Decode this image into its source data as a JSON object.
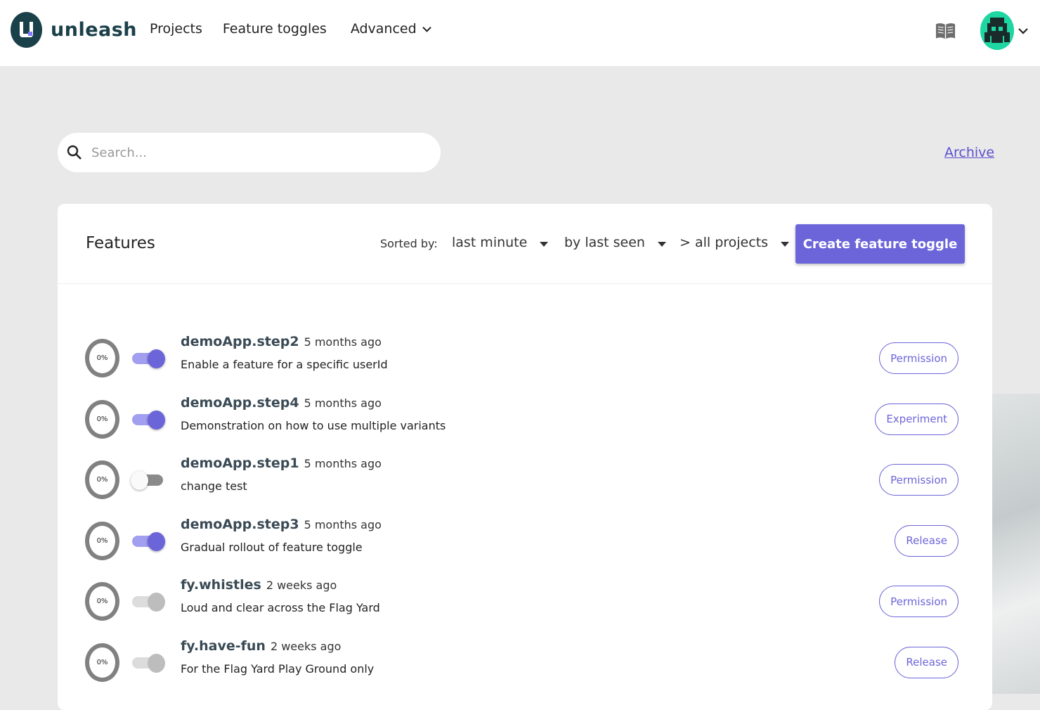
{
  "header": {
    "logo_text": "unleash",
    "nav": [
      "Projects",
      "Feature toggles",
      "Advanced"
    ],
    "icons": {
      "docs": "book-icon",
      "avatar": "user-avatar",
      "chevron": "chevron-down-icon"
    }
  },
  "search": {
    "placeholder": "Search..."
  },
  "archive_label": "Archive",
  "features_panel": {
    "title": "Features",
    "sorted_label": "Sorted by:",
    "filters": {
      "time": "last minute",
      "sort": "by last seen",
      "project": "> all projects"
    },
    "create_button": "Create feature toggle",
    "items": [
      {
        "name": "demoApp.step2",
        "time": "5 months ago",
        "description": "Enable a feature for a specific userId",
        "percent": "0%",
        "toggle": "on",
        "type": "Permission"
      },
      {
        "name": "demoApp.step4",
        "time": "5 months ago",
        "description": "Demonstration on how to use multiple variants",
        "percent": "0%",
        "toggle": "on",
        "type": "Experiment"
      },
      {
        "name": "demoApp.step1",
        "time": "5 months ago",
        "description": "change test",
        "percent": "0%",
        "toggle": "off",
        "type": "Permission"
      },
      {
        "name": "demoApp.step3",
        "time": "5 months ago",
        "description": "Gradual rollout of feature toggle",
        "percent": "0%",
        "toggle": "on",
        "type": "Release"
      },
      {
        "name": "fy.whistles",
        "time": "2 weeks ago",
        "description": "Loud and clear across the Flag Yard",
        "percent": "0%",
        "toggle": "disabled",
        "type": "Permission"
      },
      {
        "name": "fy.have-fun",
        "time": "2 weeks ago",
        "description": "For the Flag Yard Play Ground only",
        "percent": "0%",
        "toggle": "disabled",
        "type": "Release"
      }
    ]
  },
  "colors": {
    "primary": "#6c65d9",
    "logo": "#1a4049",
    "background": "#e9e9e9"
  }
}
